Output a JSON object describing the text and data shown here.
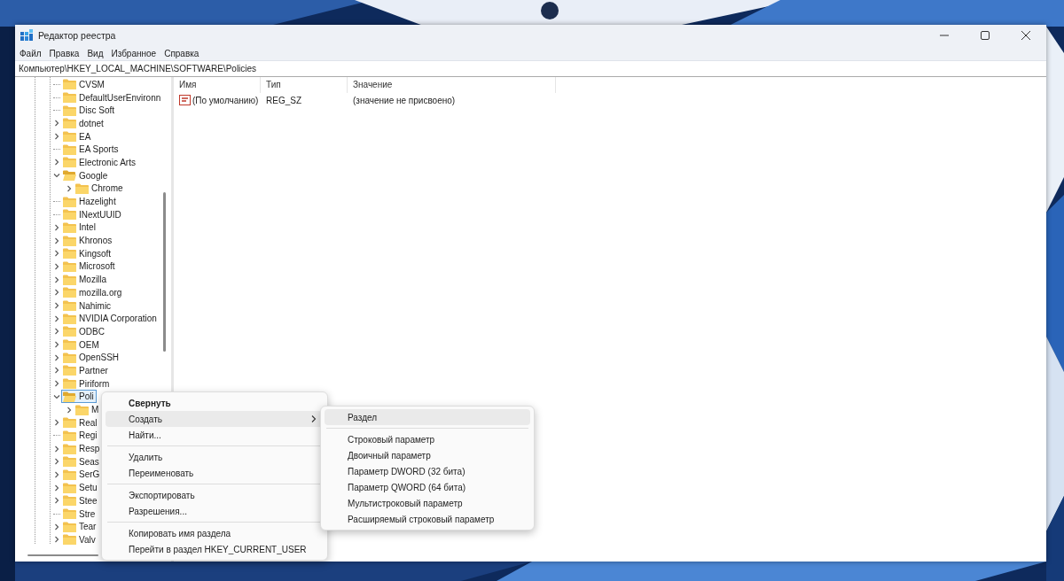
{
  "window": {
    "title": "Редактор реестра"
  },
  "menu_bar": [
    "Файл",
    "Правка",
    "Вид",
    "Избранное",
    "Справка"
  ],
  "address": "Компьютер\\HKEY_LOCAL_MACHINE\\SOFTWARE\\Policies",
  "tree": [
    {
      "name": "CVSM",
      "expandable": false,
      "expanded": false,
      "selected": false
    },
    {
      "name": "DefaultUserEnvironn",
      "expandable": false,
      "expanded": false,
      "selected": false
    },
    {
      "name": "Disc Soft",
      "expandable": false,
      "expanded": false,
      "selected": false
    },
    {
      "name": "dotnet",
      "expandable": true,
      "expanded": false,
      "selected": false
    },
    {
      "name": "EA",
      "expandable": true,
      "expanded": false,
      "selected": false
    },
    {
      "name": "EA Sports",
      "expandable": false,
      "expanded": false,
      "selected": false
    },
    {
      "name": "Electronic Arts",
      "expandable": true,
      "expanded": false,
      "selected": false
    },
    {
      "name": "Google",
      "expandable": true,
      "expanded": true,
      "selected": false,
      "children": [
        {
          "name": "Chrome",
          "expandable": true,
          "expanded": false,
          "selected": false
        }
      ]
    },
    {
      "name": "Hazelight",
      "expandable": false,
      "expanded": false,
      "selected": false
    },
    {
      "name": "INextUUID",
      "expandable": false,
      "expanded": false,
      "selected": false
    },
    {
      "name": "Intel",
      "expandable": true,
      "expanded": false,
      "selected": false
    },
    {
      "name": "Khronos",
      "expandable": true,
      "expanded": false,
      "selected": false
    },
    {
      "name": "Kingsoft",
      "expandable": true,
      "expanded": false,
      "selected": false
    },
    {
      "name": "Microsoft",
      "expandable": true,
      "expanded": false,
      "selected": false
    },
    {
      "name": "Mozilla",
      "expandable": true,
      "expanded": false,
      "selected": false
    },
    {
      "name": "mozilla.org",
      "expandable": true,
      "expanded": false,
      "selected": false
    },
    {
      "name": "Nahimic",
      "expandable": true,
      "expanded": false,
      "selected": false
    },
    {
      "name": "NVIDIA Corporation",
      "expandable": true,
      "expanded": false,
      "selected": false
    },
    {
      "name": "ODBC",
      "expandable": true,
      "expanded": false,
      "selected": false
    },
    {
      "name": "OEM",
      "expandable": true,
      "expanded": false,
      "selected": false
    },
    {
      "name": "OpenSSH",
      "expandable": true,
      "expanded": false,
      "selected": false
    },
    {
      "name": "Partner",
      "expandable": true,
      "expanded": false,
      "selected": false
    },
    {
      "name": "Piriform",
      "expandable": true,
      "expanded": false,
      "selected": false
    },
    {
      "name": "Poli",
      "expandable": true,
      "expanded": true,
      "selected": true,
      "children": [
        {
          "name": "M",
          "expandable": true,
          "expanded": false,
          "selected": false
        }
      ]
    },
    {
      "name": "Real",
      "expandable": true,
      "expanded": false,
      "selected": false
    },
    {
      "name": "Regi",
      "expandable": false,
      "expanded": false,
      "selected": false
    },
    {
      "name": "Resp",
      "expandable": true,
      "expanded": false,
      "selected": false
    },
    {
      "name": "Seas",
      "expandable": true,
      "expanded": false,
      "selected": false
    },
    {
      "name": "SerG",
      "expandable": true,
      "expanded": false,
      "selected": false
    },
    {
      "name": "Setu",
      "expandable": true,
      "expanded": false,
      "selected": false
    },
    {
      "name": "Stee",
      "expandable": true,
      "expanded": false,
      "selected": false
    },
    {
      "name": "Stre",
      "expandable": false,
      "expanded": false,
      "selected": false
    },
    {
      "name": "Tear",
      "expandable": true,
      "expanded": false,
      "selected": false
    },
    {
      "name": "Valv",
      "expandable": true,
      "expanded": false,
      "selected": false
    }
  ],
  "list": {
    "columns": [
      "Имя",
      "Тип",
      "Значение"
    ],
    "rows": [
      {
        "name": "(По умолчанию)",
        "type": "REG_SZ",
        "value": "(значение не присвоено)"
      }
    ]
  },
  "context_menu": [
    {
      "kind": "item",
      "label": "Свернуть",
      "default": true,
      "selected": false,
      "submenu": false
    },
    {
      "kind": "item",
      "label": "Создать",
      "default": false,
      "selected": true,
      "submenu": true
    },
    {
      "kind": "item",
      "label": "Найти...",
      "default": false,
      "selected": false,
      "submenu": false
    },
    {
      "kind": "separator"
    },
    {
      "kind": "item",
      "label": "Удалить",
      "default": false,
      "selected": false,
      "submenu": false
    },
    {
      "kind": "item",
      "label": "Переименовать",
      "default": false,
      "selected": false,
      "submenu": false
    },
    {
      "kind": "separator"
    },
    {
      "kind": "item",
      "label": "Экспортировать",
      "default": false,
      "selected": false,
      "submenu": false
    },
    {
      "kind": "item",
      "label": "Разрешения...",
      "default": false,
      "selected": false,
      "submenu": false
    },
    {
      "kind": "separator"
    },
    {
      "kind": "item",
      "label": "Копировать имя раздела",
      "default": false,
      "selected": false,
      "submenu": false
    },
    {
      "kind": "item",
      "label": "Перейти в раздел HKEY_CURRENT_USER",
      "default": false,
      "selected": false,
      "submenu": false
    }
  ],
  "submenu": [
    {
      "kind": "item",
      "label": "Раздел",
      "selected": true
    },
    {
      "kind": "separator"
    },
    {
      "kind": "item",
      "label": "Строковый параметр",
      "selected": false
    },
    {
      "kind": "item",
      "label": "Двоичный параметр",
      "selected": false
    },
    {
      "kind": "item",
      "label": "Параметр DWORD (32 бита)",
      "selected": false
    },
    {
      "kind": "item",
      "label": "Параметр QWORD (64 бита)",
      "selected": false
    },
    {
      "kind": "item",
      "label": "Мультистроковый параметр",
      "selected": false
    },
    {
      "kind": "item",
      "label": "Расширяемый строковый параметр",
      "selected": false
    }
  ]
}
